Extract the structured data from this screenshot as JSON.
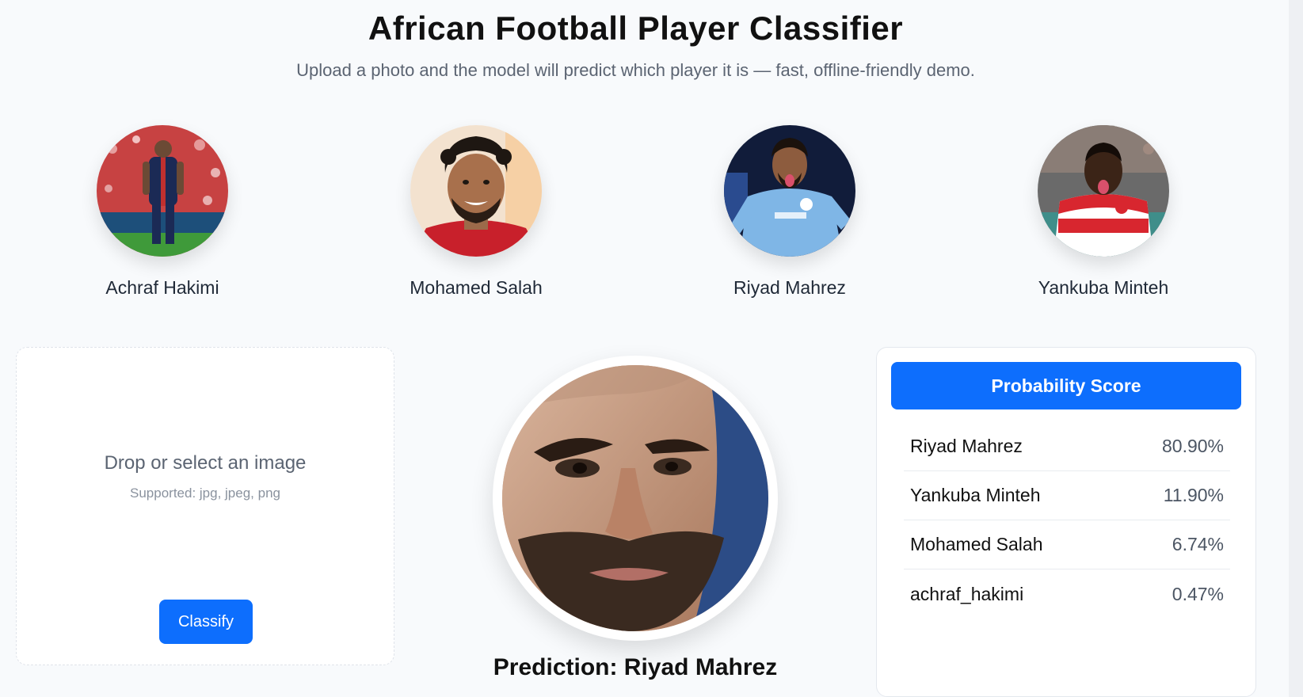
{
  "header": {
    "title": "African Football Player Classifier",
    "subtitle": "Upload a photo and the model will predict which player it is — fast, offline-friendly demo."
  },
  "gallery": [
    {
      "name": "Achraf Hakimi",
      "icon": "player-photo"
    },
    {
      "name": "Mohamed Salah",
      "icon": "player-photo"
    },
    {
      "name": "Riyad Mahrez",
      "icon": "player-photo"
    },
    {
      "name": "Yankuba Minteh",
      "icon": "player-photo"
    }
  ],
  "upload": {
    "title": "Drop or select an image",
    "supported": "Supported: jpg, jpeg, png",
    "button_label": "Classify"
  },
  "prediction": {
    "text": "Prediction: Riyad Mahrez"
  },
  "probabilities": {
    "header": "Probability Score",
    "rows": [
      {
        "name": "Riyad Mahrez",
        "value": "80.90%"
      },
      {
        "name": "Yankuba Minteh",
        "value": "11.90%"
      },
      {
        "name": "Mohamed Salah",
        "value": "6.74%"
      },
      {
        "name": "achraf_hakimi",
        "value": "0.47%"
      }
    ]
  },
  "colors": {
    "accent": "#0d6efd",
    "background": "#f8fafc"
  }
}
